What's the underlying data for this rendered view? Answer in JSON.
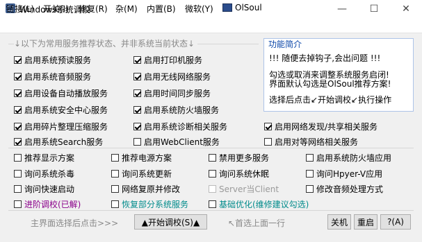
{
  "window": {
    "title": "Windows系统调校",
    "minimize_glyph": "—",
    "maximize_glyph": "☐",
    "close_glyph": "✕"
  },
  "menu": {
    "items": [
      "链接(L)",
      "开关(I)",
      "修复(R)",
      "杂(M)",
      "内置(B)",
      "微软(Y)"
    ],
    "brand": "OlSoul"
  },
  "hint": "↓以下为常用服务推荐状态、并非系统当前状态↓",
  "func_panel": {
    "title": "功能简介",
    "lines": [
      "!!! 随便去掉钩子,会出问题 !!!",
      "勾选或取消来调整系统服务启闭!",
      "界面默认勾选是OlSoul推荐方案!",
      "选择后点击↙开始调校↙执行操作"
    ]
  },
  "services": [
    {
      "label": "启用系统预读服务",
      "checked": true
    },
    {
      "label": "启用打印机服务",
      "checked": true
    },
    {
      "label": "启用系统音频服务",
      "checked": true
    },
    {
      "label": "启用无线网络服务",
      "checked": true
    },
    {
      "label": "启用设备自动播放服务",
      "checked": true
    },
    {
      "label": "启用时间同步服务",
      "checked": true
    },
    {
      "label": "启用系统安全中心服务",
      "checked": true
    },
    {
      "label": "启用系统防火墙服务",
      "checked": true
    },
    {
      "label": "启用碎片整理压缩服务",
      "checked": true
    },
    {
      "label": "启用系统诊断相关服务",
      "checked": true
    },
    {
      "label": "启用网络发现/共享相关服务",
      "checked": true
    },
    {
      "label": "启用系统Search服务",
      "checked": true
    },
    {
      "label": "启用WebClient服务",
      "checked": false
    },
    {
      "label": "启用对等网络相关服务",
      "checked": false
    }
  ],
  "options": [
    {
      "label": "推荐显示方案",
      "checked": false,
      "disabled": false
    },
    {
      "label": "推荐电源方案",
      "checked": false,
      "disabled": false
    },
    {
      "label": "禁用更多服务",
      "checked": false,
      "disabled": false
    },
    {
      "label": "启用系统防火墙应用",
      "checked": false,
      "disabled": false
    },
    {
      "label": "询问系统杀毒",
      "checked": false,
      "disabled": false
    },
    {
      "label": "询问系统更新",
      "checked": false,
      "disabled": false
    },
    {
      "label": "询问系统休眠",
      "checked": false,
      "disabled": false
    },
    {
      "label": "询问Hpyer-V应用",
      "checked": false,
      "disabled": false
    },
    {
      "label": "询问快速启动",
      "checked": false,
      "disabled": false
    },
    {
      "label": "网络复原并修改",
      "checked": false,
      "disabled": false
    },
    {
      "label": "Server当Client",
      "checked": false,
      "disabled": true
    },
    {
      "label": "修改音频处理方式",
      "checked": false,
      "disabled": false
    }
  ],
  "modes": [
    {
      "label": "进阶调校(已解)",
      "color": "#8b008b"
    },
    {
      "label": "恢复部分系统服务",
      "color": "#008b8b"
    },
    {
      "label": "基础优化(维修建议勾选)",
      "color": "#008b8b"
    }
  ],
  "footer": {
    "left_hint": "主界面选择后点击>>>",
    "start_button": "▲开始调校(S)▲",
    "right_hint": "↖首选上面一行",
    "shutdown_button": "关机",
    "restart_button": "重启",
    "help_button": "?(A)"
  }
}
